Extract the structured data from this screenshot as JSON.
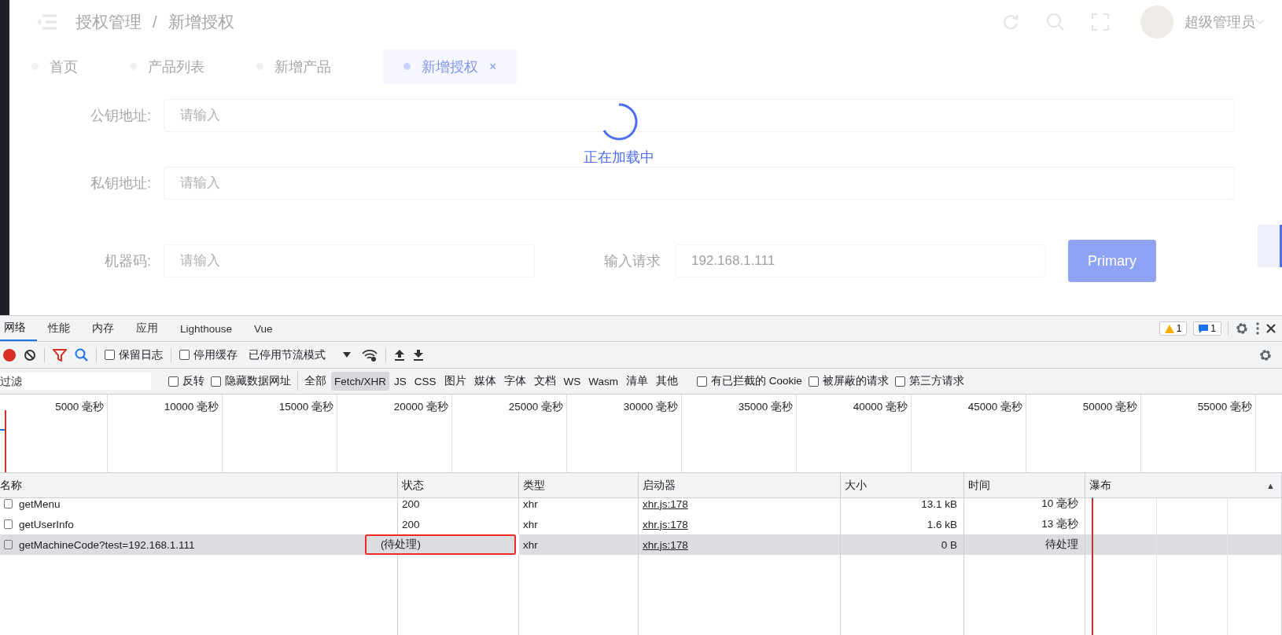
{
  "header": {
    "breadcrumb": [
      "授权管理",
      "新增授权"
    ],
    "separator": "/",
    "user": "超级管理员"
  },
  "page_tabs": [
    {
      "label": "首页",
      "selected": false
    },
    {
      "label": "产品列表",
      "selected": false
    },
    {
      "label": "新增产品",
      "selected": false
    },
    {
      "label": "新增授权",
      "selected": true,
      "close": "×"
    }
  ],
  "loading": {
    "text": "正在加载中"
  },
  "form": {
    "public_key": {
      "label": "公钥地址:",
      "placeholder": "请输入"
    },
    "private_key": {
      "label": "私钥地址:",
      "placeholder": "请输入"
    },
    "machine_code": {
      "label": "机器码:",
      "placeholder": "请输入"
    },
    "request": {
      "label": "输入请求",
      "value": "192.168.1.111"
    },
    "button": "Primary"
  },
  "devtools": {
    "tabs": [
      {
        "label": "网络",
        "selected": true
      },
      {
        "label": "性能",
        "selected": false
      },
      {
        "label": "内存",
        "selected": false
      },
      {
        "label": "应用",
        "selected": false
      },
      {
        "label": "Lighthouse",
        "selected": false
      },
      {
        "label": "Vue",
        "selected": false
      }
    ],
    "warnings": "1",
    "messages": "1",
    "toolbar": {
      "recording": true,
      "filter_active": true,
      "options": [
        {
          "label": "保留日志",
          "checked": false
        },
        {
          "label": "停用缓存",
          "checked": false
        }
      ],
      "throttle": "已停用节流模式"
    },
    "filter": {
      "placeholder": "过滤",
      "options": [
        {
          "label": "反转",
          "checked": false
        },
        {
          "label": "隐藏数据网址",
          "checked": false
        }
      ],
      "types": [
        {
          "label": "全部",
          "selected": false
        },
        {
          "label": "Fetch/XHR",
          "selected": true
        },
        {
          "label": "JS",
          "selected": false
        },
        {
          "label": "CSS",
          "selected": false
        },
        {
          "label": "图片",
          "selected": false
        },
        {
          "label": "媒体",
          "selected": false
        },
        {
          "label": "字体",
          "selected": false
        },
        {
          "label": "文档",
          "selected": false
        },
        {
          "label": "WS",
          "selected": false
        },
        {
          "label": "Wasm",
          "selected": false
        },
        {
          "label": "清单",
          "selected": false
        },
        {
          "label": "其他",
          "selected": false
        }
      ],
      "extra": [
        {
          "label": "有已拦截的 Cookie",
          "checked": false
        },
        {
          "label": "被屏蔽的请求",
          "checked": false
        },
        {
          "label": "第三方请求",
          "checked": false
        }
      ]
    },
    "timeline": {
      "ticks": [
        "5000 毫秒",
        "10000 毫秒",
        "15000 毫秒",
        "20000 毫秒",
        "25000 毫秒",
        "30000 毫秒",
        "35000 毫秒",
        "40000 毫秒",
        "45000 毫秒",
        "50000 毫秒",
        "55000 毫秒"
      ]
    },
    "table": {
      "columns": [
        "名称",
        "状态",
        "类型",
        "启动器",
        "大小",
        "时间",
        "瀑布"
      ],
      "sort_mark": "▲",
      "rows": [
        {
          "name": "getMenu",
          "status": "200",
          "type": "xhr",
          "initiator": "xhr.js:178",
          "size": "13.1 kB",
          "time": "10 毫秒",
          "selected": false,
          "highlighted": false
        },
        {
          "name": "getUserInfo",
          "status": "200",
          "type": "xhr",
          "initiator": "xhr.js:178",
          "size": "1.6 kB",
          "time": "13 毫秒",
          "selected": false,
          "highlighted": false
        },
        {
          "name": "getMachineCode?test=192.168.1.111",
          "status": "(待处理)",
          "type": "xhr",
          "initiator": "xhr.js:178",
          "size": "0 B",
          "time": "待处理",
          "selected": true,
          "highlighted": true
        }
      ]
    }
  }
}
